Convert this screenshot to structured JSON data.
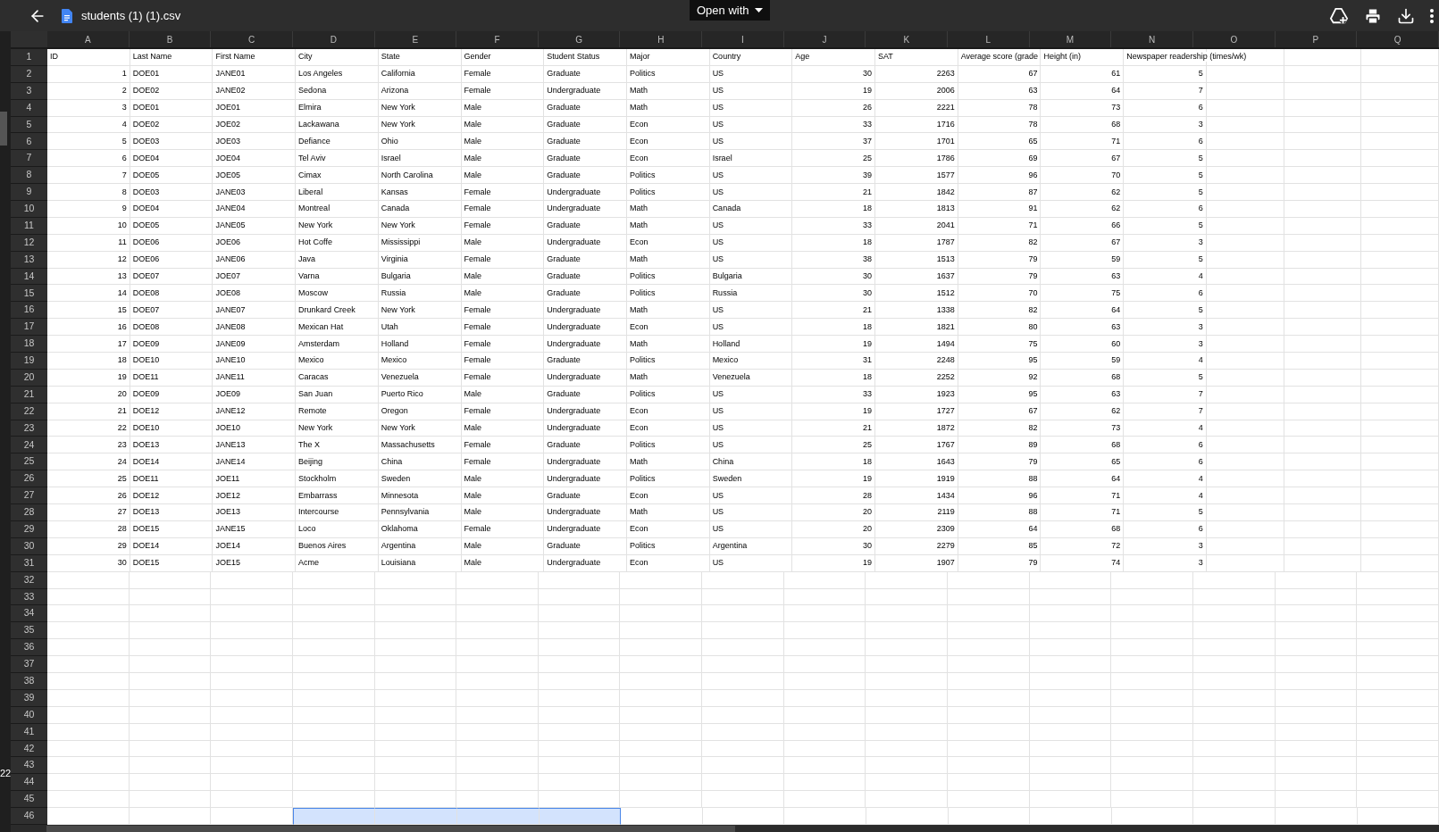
{
  "toolbar": {
    "title": "students (1) (1).csv",
    "open_with": "Open with"
  },
  "side_label": "22",
  "columns": [
    {
      "letter": "A",
      "numeric": true
    },
    {
      "letter": "B",
      "numeric": false
    },
    {
      "letter": "C",
      "numeric": false
    },
    {
      "letter": "D",
      "numeric": false
    },
    {
      "letter": "E",
      "numeric": false
    },
    {
      "letter": "F",
      "numeric": false
    },
    {
      "letter": "G",
      "numeric": false
    },
    {
      "letter": "H",
      "numeric": false
    },
    {
      "letter": "I",
      "numeric": false
    },
    {
      "letter": "J",
      "numeric": true
    },
    {
      "letter": "K",
      "numeric": true
    },
    {
      "letter": "L",
      "numeric": true
    },
    {
      "letter": "M",
      "numeric": true
    },
    {
      "letter": "N",
      "numeric": true
    },
    {
      "letter": "O"
    },
    {
      "letter": "P"
    },
    {
      "letter": "Q"
    }
  ],
  "rows": [
    {
      "number": "1",
      "kind": "header",
      "cells": [
        "ID",
        "Last Name",
        "First Name",
        "City",
        "State",
        "Gender",
        "Student Status",
        "Major",
        "Country",
        "Age",
        "SAT",
        "Average score (grade",
        "Height (in)",
        "Newspaper readership (times/wk)"
      ]
    },
    {
      "number": "2",
      "kind": "data",
      "cells": [
        "1",
        "DOE01",
        "JANE01",
        "Los Angeles",
        "California",
        "Female",
        "Graduate",
        "Politics",
        "US",
        "30",
        "2263",
        "67",
        "61",
        "5"
      ]
    },
    {
      "number": "3",
      "kind": "data",
      "cells": [
        "2",
        "DOE02",
        "JANE02",
        "Sedona",
        "Arizona",
        "Female",
        "Undergraduate",
        "Math",
        "US",
        "19",
        "2006",
        "63",
        "64",
        "7"
      ]
    },
    {
      "number": "4",
      "kind": "data",
      "cells": [
        "3",
        "DOE01",
        "JOE01",
        "Elmira",
        "New York",
        "Male",
        "Graduate",
        "Math",
        "US",
        "26",
        "2221",
        "78",
        "73",
        "6"
      ]
    },
    {
      "number": "5",
      "kind": "data",
      "cells": [
        "4",
        "DOE02",
        "JOE02",
        "Lackawana",
        "New York",
        "Male",
        "Graduate",
        "Econ",
        "US",
        "33",
        "1716",
        "78",
        "68",
        "3"
      ]
    },
    {
      "number": "6",
      "kind": "data",
      "cells": [
        "5",
        "DOE03",
        "JOE03",
        "Defiance",
        "Ohio",
        "Male",
        "Graduate",
        "Econ",
        "US",
        "37",
        "1701",
        "65",
        "71",
        "6"
      ]
    },
    {
      "number": "7",
      "kind": "data",
      "cells": [
        "6",
        "DOE04",
        "JOE04",
        "Tel Aviv",
        "Israel",
        "Male",
        "Graduate",
        "Econ",
        "Israel",
        "25",
        "1786",
        "69",
        "67",
        "5"
      ]
    },
    {
      "number": "8",
      "kind": "data",
      "cells": [
        "7",
        "DOE05",
        "JOE05",
        "Cimax",
        "North Carolina",
        "Male",
        "Graduate",
        "Politics",
        "US",
        "39",
        "1577",
        "96",
        "70",
        "5"
      ]
    },
    {
      "number": "9",
      "kind": "data",
      "cells": [
        "8",
        "DOE03",
        "JANE03",
        "Liberal",
        "Kansas",
        "Female",
        "Undergraduate",
        "Politics",
        "US",
        "21",
        "1842",
        "87",
        "62",
        "5"
      ]
    },
    {
      "number": "10",
      "kind": "data",
      "cells": [
        "9",
        "DOE04",
        "JANE04",
        "Montreal",
        "Canada",
        "Female",
        "Undergraduate",
        "Math",
        "Canada",
        "18",
        "1813",
        "91",
        "62",
        "6"
      ]
    },
    {
      "number": "11",
      "kind": "data",
      "cells": [
        "10",
        "DOE05",
        "JANE05",
        "New York",
        "New York",
        "Female",
        "Graduate",
        "Math",
        "US",
        "33",
        "2041",
        "71",
        "66",
        "5"
      ]
    },
    {
      "number": "12",
      "kind": "data",
      "cells": [
        "11",
        "DOE06",
        "JOE06",
        "Hot Coffe",
        "Mississippi",
        "Male",
        "Undergraduate",
        "Econ",
        "US",
        "18",
        "1787",
        "82",
        "67",
        "3"
      ]
    },
    {
      "number": "13",
      "kind": "data",
      "cells": [
        "12",
        "DOE06",
        "JANE06",
        "Java",
        "Virginia",
        "Female",
        "Graduate",
        "Math",
        "US",
        "38",
        "1513",
        "79",
        "59",
        "5"
      ]
    },
    {
      "number": "14",
      "kind": "data",
      "cells": [
        "13",
        "DOE07",
        "JOE07",
        "Varna",
        "Bulgaria",
        "Male",
        "Graduate",
        "Politics",
        "Bulgaria",
        "30",
        "1637",
        "79",
        "63",
        "4"
      ]
    },
    {
      "number": "15",
      "kind": "data",
      "cells": [
        "14",
        "DOE08",
        "JOE08",
        "Moscow",
        "Russia",
        "Male",
        "Graduate",
        "Politics",
        "Russia",
        "30",
        "1512",
        "70",
        "75",
        "6"
      ]
    },
    {
      "number": "16",
      "kind": "data",
      "cells": [
        "15",
        "DOE07",
        "JANE07",
        "Drunkard Creek",
        "New York",
        "Female",
        "Undergraduate",
        "Math",
        "US",
        "21",
        "1338",
        "82",
        "64",
        "5"
      ]
    },
    {
      "number": "17",
      "kind": "data",
      "cells": [
        "16",
        "DOE08",
        "JANE08",
        "Mexican Hat",
        "Utah",
        "Female",
        "Undergraduate",
        "Econ",
        "US",
        "18",
        "1821",
        "80",
        "63",
        "3"
      ]
    },
    {
      "number": "18",
      "kind": "data",
      "cells": [
        "17",
        "DOE09",
        "JANE09",
        "Amsterdam",
        "Holland",
        "Female",
        "Undergraduate",
        "Math",
        "Holland",
        "19",
        "1494",
        "75",
        "60",
        "3"
      ]
    },
    {
      "number": "19",
      "kind": "data",
      "cells": [
        "18",
        "DOE10",
        "JANE10",
        "Mexico",
        "Mexico",
        "Female",
        "Graduate",
        "Politics",
        "Mexico",
        "31",
        "2248",
        "95",
        "59",
        "4"
      ]
    },
    {
      "number": "20",
      "kind": "data",
      "cells": [
        "19",
        "DOE11",
        "JANE11",
        "Caracas",
        "Venezuela",
        "Female",
        "Undergraduate",
        "Math",
        "Venezuela",
        "18",
        "2252",
        "92",
        "68",
        "5"
      ]
    },
    {
      "number": "21",
      "kind": "data",
      "cells": [
        "20",
        "DOE09",
        "JOE09",
        "San Juan",
        "Puerto Rico",
        "Male",
        "Graduate",
        "Politics",
        "US",
        "33",
        "1923",
        "95",
        "63",
        "7"
      ]
    },
    {
      "number": "22",
      "kind": "data",
      "cells": [
        "21",
        "DOE12",
        "JANE12",
        "Remote",
        "Oregon",
        "Female",
        "Undergraduate",
        "Econ",
        "US",
        "19",
        "1727",
        "67",
        "62",
        "7"
      ]
    },
    {
      "number": "23",
      "kind": "data",
      "cells": [
        "22",
        "DOE10",
        "JOE10",
        "New York",
        "New York",
        "Male",
        "Undergraduate",
        "Econ",
        "US",
        "21",
        "1872",
        "82",
        "73",
        "4"
      ]
    },
    {
      "number": "24",
      "kind": "data",
      "cells": [
        "23",
        "DOE13",
        "JANE13",
        "The X",
        "Massachusetts",
        "Female",
        "Graduate",
        "Politics",
        "US",
        "25",
        "1767",
        "89",
        "68",
        "6"
      ]
    },
    {
      "number": "25",
      "kind": "data",
      "cells": [
        "24",
        "DOE14",
        "JANE14",
        "Beijing",
        "China",
        "Female",
        "Undergraduate",
        "Math",
        "China",
        "18",
        "1643",
        "79",
        "65",
        "6"
      ]
    },
    {
      "number": "26",
      "kind": "data",
      "cells": [
        "25",
        "DOE11",
        "JOE11",
        "Stockholm",
        "Sweden",
        "Male",
        "Undergraduate",
        "Politics",
        "Sweden",
        "19",
        "1919",
        "88",
        "64",
        "4"
      ]
    },
    {
      "number": "27",
      "kind": "data",
      "cells": [
        "26",
        "DOE12",
        "JOE12",
        "Embarrass",
        "Minnesota",
        "Male",
        "Graduate",
        "Econ",
        "US",
        "28",
        "1434",
        "96",
        "71",
        "4"
      ]
    },
    {
      "number": "28",
      "kind": "data",
      "cells": [
        "27",
        "DOE13",
        "JOE13",
        "Intercourse",
        "Pennsylvania",
        "Male",
        "Undergraduate",
        "Math",
        "US",
        "20",
        "2119",
        "88",
        "71",
        "5"
      ]
    },
    {
      "number": "29",
      "kind": "data",
      "cells": [
        "28",
        "DOE15",
        "JANE15",
        "Loco",
        "Oklahoma",
        "Female",
        "Undergraduate",
        "Econ",
        "US",
        "20",
        "2309",
        "64",
        "68",
        "6"
      ]
    },
    {
      "number": "30",
      "kind": "data",
      "cells": [
        "29",
        "DOE14",
        "JOE14",
        "Buenos Aires",
        "Argentina",
        "Male",
        "Graduate",
        "Politics",
        "Argentina",
        "30",
        "2279",
        "85",
        "72",
        "3"
      ]
    },
    {
      "number": "31",
      "kind": "data",
      "cells": [
        "30",
        "DOE15",
        "JOE15",
        "Acme",
        "Louisiana",
        "Male",
        "Undergraduate",
        "Econ",
        "US",
        "19",
        "1907",
        "79",
        "74",
        "3"
      ]
    },
    {
      "number": "32",
      "kind": "empty"
    },
    {
      "number": "33",
      "kind": "empty"
    },
    {
      "number": "34",
      "kind": "empty"
    },
    {
      "number": "35",
      "kind": "empty"
    },
    {
      "number": "36",
      "kind": "empty"
    },
    {
      "number": "37",
      "kind": "empty"
    },
    {
      "number": "38",
      "kind": "empty"
    },
    {
      "number": "39",
      "kind": "empty"
    },
    {
      "number": "40",
      "kind": "empty"
    },
    {
      "number": "41",
      "kind": "empty"
    },
    {
      "number": "42",
      "kind": "empty"
    },
    {
      "number": "43",
      "kind": "empty"
    },
    {
      "number": "44",
      "kind": "empty"
    },
    {
      "number": "45",
      "kind": "empty"
    },
    {
      "number": "46",
      "kind": "empty",
      "selected": [
        false,
        false,
        false,
        true,
        true,
        true,
        true,
        false,
        false,
        false,
        false,
        false,
        false,
        false,
        false,
        false,
        false
      ]
    }
  ]
}
